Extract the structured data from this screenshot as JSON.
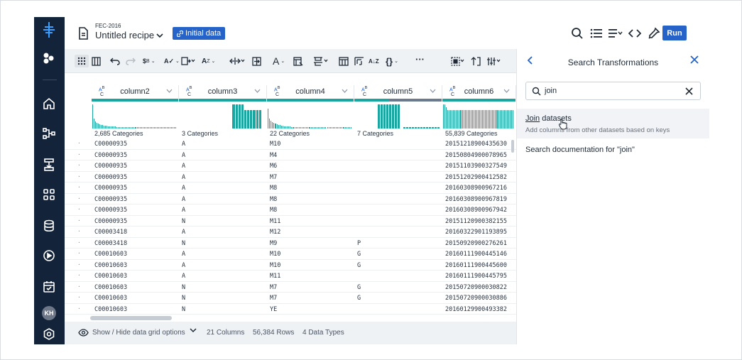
{
  "header": {
    "dataset_name": "FEC-2016",
    "recipe_name": "Untitled recipe",
    "badge_label": "Initial data",
    "run_label": "Run"
  },
  "sidebar": {
    "avatar_initials": "KH",
    "icons": [
      "logo-icon",
      "apps-icon",
      "home-icon",
      "flow-icon",
      "transform-icon",
      "grid-icon",
      "database-icon",
      "play-icon",
      "calendar-icon",
      "avatar",
      "settings-icon"
    ]
  },
  "toolbar": {
    "icons": [
      "grid-view-icon",
      "columns-view-icon",
      "undo-icon",
      "redo-icon",
      "replace-icon",
      "validate-icon",
      "split-icon",
      "sort-icon",
      "move-icon",
      "expand-icon",
      "text-format-icon",
      "restructure-icon",
      "filter-icon",
      "join-icon",
      "pivot-icon",
      "sort-az-icon",
      "braces-icon",
      "more-icon",
      "select-icon",
      "merge-icon",
      "settings-columns-icon"
    ]
  },
  "grid": {
    "columns": [
      {
        "name": "column2",
        "type": "ABC",
        "categories": "2,685 Categories"
      },
      {
        "name": "column3",
        "type": "ABC",
        "categories": "3 Categories"
      },
      {
        "name": "column4",
        "type": "ABC",
        "categories": "22 Categories"
      },
      {
        "name": "column5",
        "type": "ABC",
        "categories": "7 Categories"
      },
      {
        "name": "column6",
        "type": "ABC",
        "categories": "55,839 Categories"
      }
    ],
    "rows": [
      [
        "C00000935",
        "A",
        "M10",
        "",
        "20151218900435630"
      ],
      [
        "C00000935",
        "A",
        "M4",
        "",
        "20150804900078965"
      ],
      [
        "C00000935",
        "A",
        "M6",
        "",
        "20151103900327549"
      ],
      [
        "C00000935",
        "A",
        "M7",
        "",
        "20151202900412582"
      ],
      [
        "C00000935",
        "A",
        "M8",
        "",
        "20160308900967216"
      ],
      [
        "C00000935",
        "A",
        "M8",
        "",
        "20160308900967819"
      ],
      [
        "C00000935",
        "A",
        "M8",
        "",
        "20160308900967942"
      ],
      [
        "C00000935",
        "N",
        "M11",
        "",
        "20151120900382155"
      ],
      [
        "C00003418",
        "A",
        "M12",
        "",
        "20160322901193895"
      ],
      [
        "C00003418",
        "N",
        "M9",
        "P",
        "20150920900276261"
      ],
      [
        "C00010603",
        "A",
        "M10",
        "G",
        "20160111900445146"
      ],
      [
        "C00010603",
        "A",
        "M10",
        "G",
        "20160111900445600"
      ],
      [
        "C00010603",
        "A",
        "M11",
        "",
        "20160111900445795"
      ],
      [
        "C00010603",
        "N",
        "M7",
        "G",
        "20150720900030822"
      ],
      [
        "C00010603",
        "N",
        "M7",
        "G",
        "20150720900030886"
      ],
      [
        "C00010603",
        "N",
        "YE",
        "",
        "20160129900493382"
      ]
    ]
  },
  "footer": {
    "grid_options": "Show / Hide data grid options",
    "columns": "21 Columns",
    "rows": "56,384 Rows",
    "types": "4 Data Types"
  },
  "panel": {
    "title": "Search Transformations",
    "search_value": "join",
    "result1_title_prefix": "Join",
    "result1_title_suffix": " datasets",
    "result1_desc": "Add columns from other datasets based on keys",
    "result2": "Search documentation for \"join\""
  },
  "colors": {
    "sidebar": "#13233a",
    "accent": "#2563c9",
    "teal": "#1aa6a0",
    "toolbar": "#eff2f5"
  }
}
